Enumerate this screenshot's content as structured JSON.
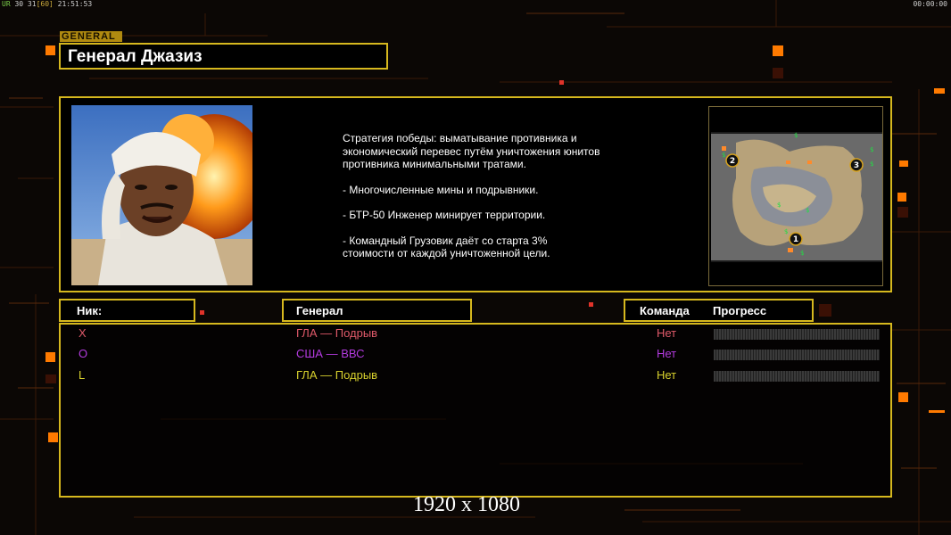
{
  "status": {
    "left_prefix": "UR",
    "left_fps": "30 31",
    "left_cap": "[60]",
    "left_time": "21:51:53",
    "right_time": "00:00:00"
  },
  "general_tag": "GENERAL",
  "title": "Генерал Джазиз",
  "description": [
    "Стратегия победы: выматывание противника и\n экономический перевес путём уничтожения юнитов\n противника минимальными тратами.",
    "- Многочисленные мины и подрывники.",
    "- БТР-50 Инженер минирует территории.",
    "- Командный Грузовик даёт со старта 3%\n стоимости от каждой уничтоженной цели."
  ],
  "minimap": {
    "start_positions": [
      "2",
      "3",
      "1"
    ]
  },
  "headers": {
    "nick": "Ник:",
    "general": "Генерал",
    "team": "Команда",
    "progress": "Прогресс"
  },
  "players": [
    {
      "nick": "X",
      "general": "ГЛА — Подрыв",
      "team": "Нет",
      "progress": 0,
      "color": "#e05a6a"
    },
    {
      "nick": "O",
      "general": "США — ВВС",
      "team": "Нет",
      "progress": 0,
      "color": "#b43be0"
    },
    {
      "nick": "L",
      "general": "ГЛА — Подрыв",
      "team": "Нет",
      "progress": 0,
      "color": "#d8d12e"
    }
  ],
  "resolution_label": "1920 x 1080",
  "colors": {
    "accent": "#d6b81e",
    "orange": "#ff7a00"
  }
}
